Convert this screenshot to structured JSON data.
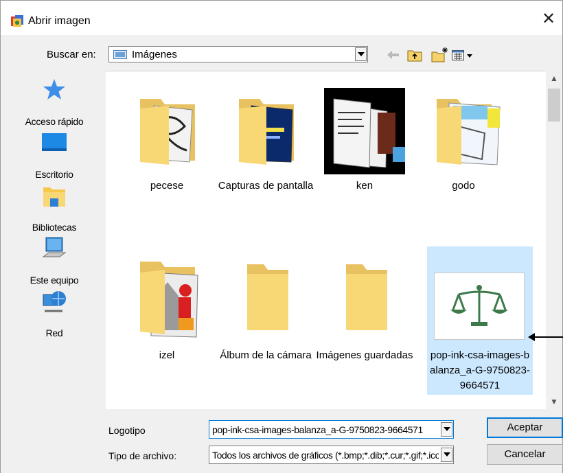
{
  "window": {
    "title": "Abrir imagen",
    "close_glyph": "✕"
  },
  "lookin": {
    "label": "Buscar en:",
    "value": "Imágenes"
  },
  "toolbar": {
    "back_icon": "back-arrow-icon",
    "up_icon": "up-folder-icon",
    "new_folder_icon": "new-folder-icon",
    "view_icon": "view-menu-icon"
  },
  "places": [
    {
      "label": "Acceso rápido",
      "icon": "star-icon"
    },
    {
      "label": "Escritorio",
      "icon": "desktop-icon"
    },
    {
      "label": "Bibliotecas",
      "icon": "libraries-icon"
    },
    {
      "label": "Este equipo",
      "icon": "computer-icon"
    },
    {
      "label": "Red",
      "icon": "network-icon"
    }
  ],
  "files": [
    {
      "name": "pecese",
      "type": "folder"
    },
    {
      "name": "Capturas de pantalla",
      "type": "folder"
    },
    {
      "name": "ken",
      "type": "folder"
    },
    {
      "name": "godo",
      "type": "folder"
    },
    {
      "name": "izel",
      "type": "folder"
    },
    {
      "name": "Álbum de la cámara",
      "type": "folder"
    },
    {
      "name": "Imágenes guardadas",
      "type": "folder"
    },
    {
      "name": "pop-ink-csa-images-balanza_a-G-9750823-9664571",
      "type": "image",
      "selected": true
    }
  ],
  "filename": {
    "label": "Logotipo",
    "value": "pop-ink-csa-images-balanza_a-G-9750823-9664571"
  },
  "filetype": {
    "label": "Tipo de archivo:",
    "value": "Todos los archivos de gráficos (*.bmp;*.dib;*.cur;*.gif;*.ico;*.jpg;*.jpeg;*.png)"
  },
  "buttons": {
    "ok": "Aceptar",
    "cancel": "Cancelar"
  },
  "colors": {
    "accent": "#0078d7",
    "selection": "#cce8ff",
    "folder": "#f8d775"
  }
}
